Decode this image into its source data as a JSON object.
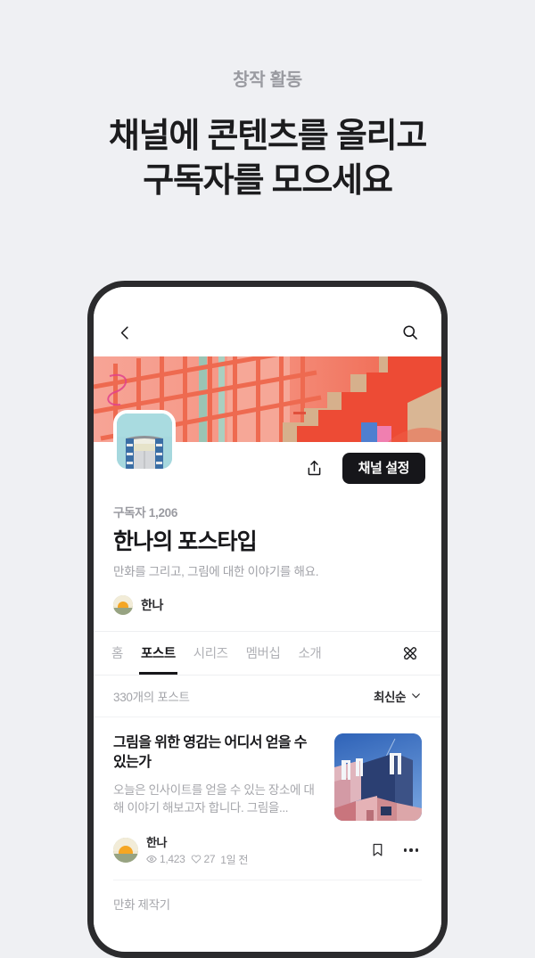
{
  "hero": {
    "eyebrow": "창작 활동",
    "title_line1": "채널에 콘텐츠를 올리고",
    "title_line2": "구독자를 모으세요"
  },
  "phone": {
    "nav": {
      "back_icon": "chevron-left-icon",
      "search_icon": "search-icon"
    },
    "cover": {
      "alt": "coral stairway railing photo"
    },
    "channel": {
      "avatar_alt": "teal sky building thumbnail",
      "share_icon": "share-icon",
      "settings_label": "채널 설정",
      "subscribers": "구독자 1,206",
      "name": "한나의 포스타입",
      "description": "만화를 그리고, 그림에 대한 이야기를 해요.",
      "owner_name": "한나"
    },
    "tabs": [
      {
        "label": "홈",
        "active": false
      },
      {
        "label": "포스트",
        "active": true
      },
      {
        "label": "시리즈",
        "active": false
      },
      {
        "label": "멤버십",
        "active": false
      },
      {
        "label": "소개",
        "active": false
      }
    ],
    "write_icon": "write-pen-icon",
    "list_header": {
      "count_label": "330개의 포스트",
      "sort_label": "최신순",
      "sort_icon": "chevron-down-icon"
    },
    "post": {
      "title": "그림을 위한 영감는 어디서 얻을 수 있는가",
      "excerpt": "오늘은 인사이트를 얻을 수 있는 장소에 대해 이야기 해보고자 합니다. 그림을...",
      "thumb_alt": "pink and blue architecture photo",
      "author": "한나",
      "views_icon": "eye-icon",
      "views": "1,423",
      "likes_icon": "heart-icon",
      "likes": "27",
      "time": "1일 전",
      "bookmark_icon": "bookmark-icon",
      "more_icon": "more-horizontal-icon"
    },
    "next_item_label": "만화 제작기"
  },
  "colors": {
    "page_bg": "#eff0f3",
    "frame": "#2b2b2d",
    "accent_dark": "#16161a",
    "cover_coral": "#ed4b35",
    "muted_text": "#a5a6ab"
  }
}
